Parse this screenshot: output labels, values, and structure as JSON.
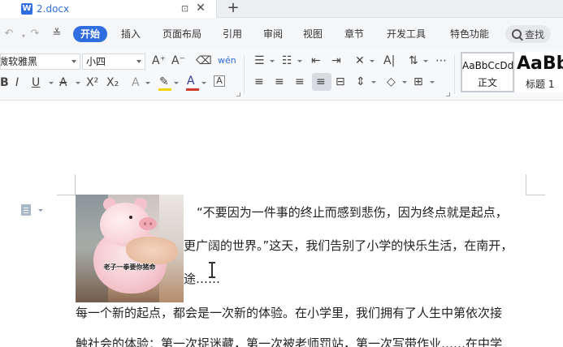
{
  "tab": {
    "icon_letter": "W",
    "title": "2.docx",
    "pin_glyph": "⊡",
    "close_glyph": "✕",
    "new_tab_glyph": "+"
  },
  "quick_access": {
    "undo": "↶",
    "redo": "↷",
    "customize": "≚"
  },
  "menu": {
    "items": [
      "开始",
      "插入",
      "页面布局",
      "引用",
      "审阅",
      "视图",
      "章节",
      "开发工具",
      "特色功能"
    ],
    "active_index": 0,
    "search_label": "查找"
  },
  "ribbon": {
    "font_name": "微软雅黑",
    "font_size": "小四",
    "grow_font": "A⁺",
    "shrink_font": "A⁻",
    "eraser": "⌫",
    "phonetic": "wén",
    "bold": "B",
    "italic": "I",
    "underline": "U",
    "strike": "A",
    "superscript": "X²",
    "subscript": "X₂",
    "text_effect": "A",
    "highlight": "✎",
    "font_color": "A",
    "char_border": "A",
    "accent_highlight": "#f2d400",
    "accent_font_color": "#d23a2c",
    "bullets": "☰",
    "numbering": "☷",
    "outdent": "⇤",
    "indent": "⇥",
    "chinese_layout": "✕",
    "text_direction": "A|",
    "sort": "⇅",
    "show_marks": "⋯",
    "align_left": "≡",
    "align_center": "≡",
    "align_right": "≡",
    "justify": "≡",
    "distributed": "⊟",
    "line_spacing": "⇕",
    "shading": "◇",
    "borders": "⊞",
    "styles": [
      {
        "sample": "AaBbCcDd",
        "name": "正文"
      },
      {
        "sample": "AaBb",
        "name": "标题 1"
      }
    ]
  },
  "image": {
    "caption": "老子一拳要你猪命",
    "colors": {
      "pig": "#f5c9cf",
      "bg": "#c9c2bf"
    }
  },
  "document": {
    "lines": [
      "“不要因为一件事的终止而感到悲伤，因为终点就是起点，",
      "更广阔的世界。”这天，我们告别了小学的快乐生活，在南开，",
      "途……",
      "每一个新的起点，都会是一次新的体验。在小学里，我们拥有了人生中第依次接",
      "触社会的体验：第一次捉迷藏，第一次被老师罚站，第一次写带作业……在中学"
    ]
  }
}
